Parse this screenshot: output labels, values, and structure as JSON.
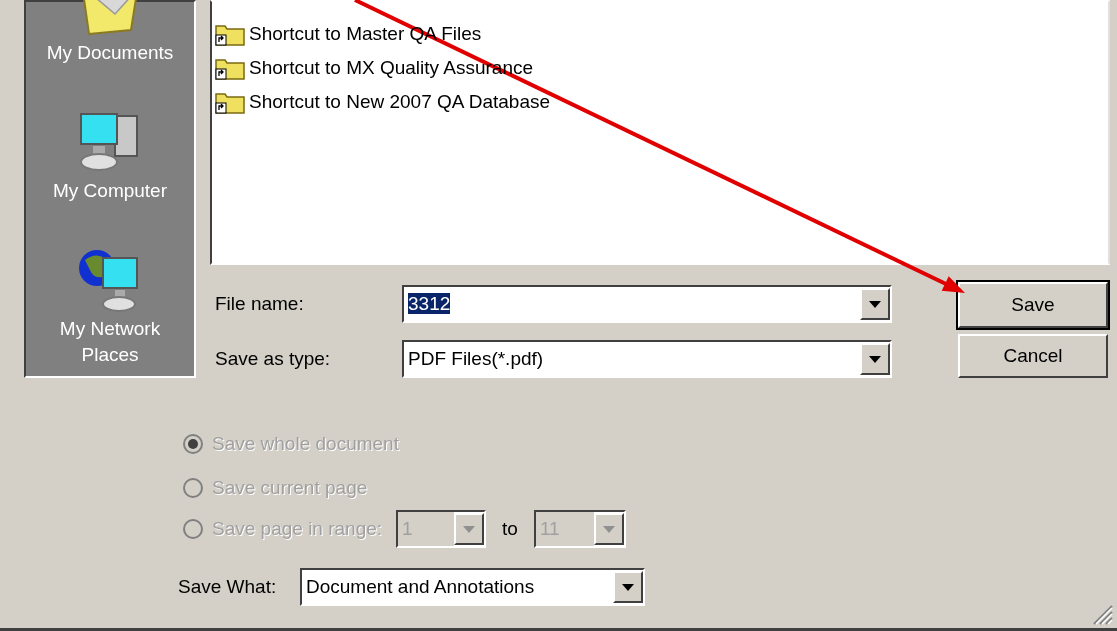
{
  "places": [
    {
      "label": "My Documents",
      "kind": "documents"
    },
    {
      "label": "My Computer",
      "kind": "computer"
    },
    {
      "label": "My Network Places",
      "kind": "network"
    }
  ],
  "files": [
    {
      "name": "Shortcut to Master QA Files"
    },
    {
      "name": "Shortcut to MX Quality Assurance"
    },
    {
      "name": "Shortcut to New 2007 QA Database"
    }
  ],
  "file_name": {
    "label": "File name:",
    "value": "3312",
    "value_selected": true
  },
  "save_as_type": {
    "label": "Save as type:",
    "value": "PDF Files(*.pdf)"
  },
  "buttons": [
    {
      "label": "Save",
      "default": true
    },
    {
      "label": "Cancel",
      "default": false
    }
  ],
  "page_options": {
    "disabled": true,
    "options": [
      {
        "label": "Save whole document",
        "selected": true
      },
      {
        "label": "Save current page",
        "selected": false
      },
      {
        "label": "Save page in range:",
        "selected": false
      }
    ],
    "range_from": "1",
    "range_to_label": "to",
    "range_to": "11"
  },
  "save_what": {
    "label": "Save What:",
    "value": "Document and Annotations"
  }
}
